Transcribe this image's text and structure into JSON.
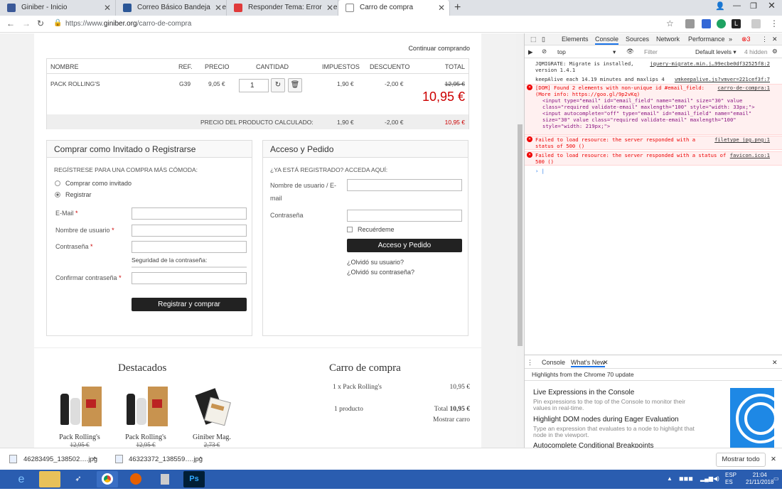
{
  "browser": {
    "tabs": [
      {
        "label": "Giniber - Inicio",
        "icon": "facebook-icon",
        "color": "#3b5998"
      },
      {
        "label": "Correo Básico Bandeja de entrada",
        "icon": "mail-icon",
        "color": "#2b5797"
      },
      {
        "label": "Responder Tema: Error One Page",
        "icon": "forum-icon",
        "color": "#e03a3a"
      },
      {
        "label": "Carro de compra",
        "icon": "page-icon",
        "color": "#888888"
      }
    ],
    "url_prefix": "https://www.",
    "url_domain": "giniber.org",
    "url_path": "/carro-de-compra"
  },
  "cart": {
    "continue_label": "Continuar comprando",
    "headers": {
      "name": "NOMBRE",
      "ref": "REF.",
      "price": "PRECIO",
      "qty": "CANTIDAD",
      "tax": "IMPUESTOS",
      "discount": "DESCUENTO",
      "total": "TOTAL"
    },
    "item": {
      "name": "PACK ROLLING'S",
      "ref": "G39",
      "price": "9,05 €",
      "qty": "1",
      "tax": "1,90 €",
      "discount": "-2,00 €",
      "old_total": "12,95 €",
      "total": "10,95 €"
    },
    "calc": {
      "label": "PRECIO DEL PRODUCTO CALCULADO:",
      "tax": "1,90 €",
      "discount": "-2,00 €",
      "total": "10,95 €"
    }
  },
  "guest_box": {
    "title": "Comprar como Invitado o Registrarse",
    "subtitle": "REGÍSTRESE PARA UNA COMPRA MÁS CÓMODA:",
    "option_guest": "Comprar como invitado",
    "option_register": "Registrar",
    "email_label": "E-Mail",
    "username_label": "Nombre de usuario",
    "password_label": "Contraseña",
    "strength_label": "Seguridad de la contraseña:",
    "confirm_label": "Confirmar contraseña",
    "required_mark": "*",
    "submit_label": "Registrar y comprar"
  },
  "login_box": {
    "title": "Acceso y Pedido",
    "subtitle": "¿YA ESTÁ REGISTRADO? ACCEDA AQUÍ:",
    "username_label_1": "Nombre de usuario / E-",
    "username_label_2": "mail",
    "password_label": "Contraseña",
    "remember_label": "Recuérdeme",
    "submit_label": "Acceso y Pedido",
    "forgot_user": "¿Olvidó su usuario?",
    "forgot_password": "¿Olvidó su contraseña?"
  },
  "featured": {
    "title": "Destacados",
    "products": [
      {
        "name": "Pack Rolling's",
        "price": "12,95 €"
      },
      {
        "name": "Pack Rolling's",
        "price": "12,95 €"
      },
      {
        "name": "Giniber Mag.",
        "price": "2,73 €"
      }
    ]
  },
  "mini_cart": {
    "title": "Carro de compra",
    "line": "1 x Pack Rolling's",
    "line_price": "10,95 €",
    "count": "1 producto",
    "total_label": "Total",
    "total_value": "10,95 €",
    "show_label": "Mostrar carro"
  },
  "devtools": {
    "tabs": [
      "Elements",
      "Console",
      "Sources",
      "Network",
      "Performance"
    ],
    "more": "»",
    "error_count": "3",
    "context": "top",
    "filter_placeholder": "Filter",
    "levels": "Default levels ▾",
    "hidden": "4 hidden",
    "log": [
      {
        "type": "info",
        "text": "JQMIGRATE: Migrate is installed, version 1.4.1",
        "src": "jquery-migrate.min.j…99ecbe0df32525f8:2"
      },
      {
        "type": "info",
        "text": "keepAlive each 14.19 minutes and maxlips 4",
        "src": "vmkeepalive.js?vmver=221cef3f:7"
      },
      {
        "type": "error",
        "text": "[DOM] Found 2 elements with non-unique id #email_field: (More info: https://goo.gl/9p2vKq)",
        "src": "carro-de-compra:1"
      },
      {
        "type": "error",
        "text": "Failed to load resource: the server responded with a status of 500 ()",
        "src": "filetype_jpg.png:1"
      },
      {
        "type": "error",
        "text": "Failed to load resource: the server responded with a status of 500 ()",
        "src": "favicon.ico:1"
      }
    ],
    "code1": "<input type=\"email\" id=\"email_field\" name=\"email\" size=\"30\" value class=\"required validate-email\" maxlength=\"100\" style=\"width: 33px;\">",
    "code2": "<input autocomplete=\"off\" type=\"email\" id=\"email_field\" name=\"email\" size=\"30\" value class=\"required validate-email\" maxlength=\"100\" style=\"width: 219px;\">",
    "drawer_tabs": [
      "Console",
      "What's New"
    ],
    "whatsnew_sub": "Highlights from the Chrome 70 update",
    "whatsnew": [
      {
        "title": "Live Expressions in the Console",
        "desc": "Pin expressions to the top of the Console to monitor their values in real-time."
      },
      {
        "title": "Highlight DOM nodes during Eager Evaluation",
        "desc": "Type an expression that evaluates to a node to highlight that node in the viewport."
      },
      {
        "title": "Autocomplete Conditional Breakpoints",
        "desc": ""
      }
    ]
  },
  "downloads": {
    "files": [
      "46283495_138502….jpg",
      "46323372_138559….jpg"
    ],
    "show_all": "Mostrar todo"
  },
  "taskbar": {
    "lang": "ESP",
    "lang2": "ES",
    "time": "21:04",
    "date": "21/11/2018"
  }
}
